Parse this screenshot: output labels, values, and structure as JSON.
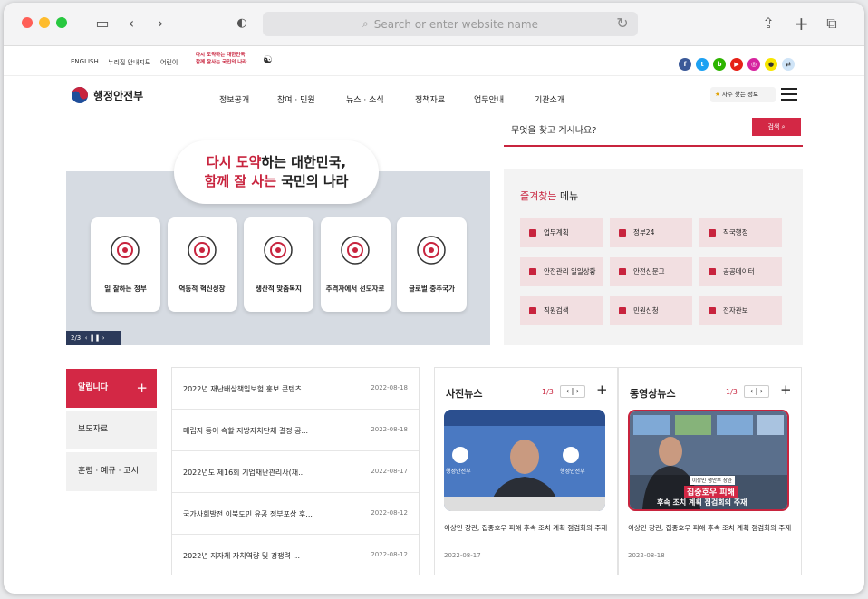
{
  "browser": {
    "url_placeholder": "Search or enter website name"
  },
  "util": {
    "english": "ENGLISH",
    "sitemap": "누리집 안내지도",
    "kids": "어린이",
    "slogan1": "다시 도약하는 대한민국",
    "slogan2": "함께 잘사는 국민의 나라"
  },
  "social": [
    {
      "name": "facebook-icon",
      "color": "#3b5998",
      "glyph": "f"
    },
    {
      "name": "twitter-icon",
      "color": "#1da1f2",
      "glyph": "t"
    },
    {
      "name": "blog-icon",
      "color": "#2db400",
      "glyph": "b"
    },
    {
      "name": "youtube-icon",
      "color": "#e62117",
      "glyph": "▶"
    },
    {
      "name": "instagram-icon",
      "color": "#d6249f",
      "glyph": "◎"
    },
    {
      "name": "kakao-icon",
      "color": "#f7e600",
      "glyph": "●"
    },
    {
      "name": "share-icon",
      "color": "#cfe4f7",
      "glyph": "⇄"
    }
  ],
  "header": {
    "logo": "행정안전부",
    "menu": [
      "정보공개",
      "참여 · 민원",
      "뉴스 · 소식",
      "정책자료",
      "업무안내",
      "기관소개"
    ],
    "fav": "자주 찾는 정보"
  },
  "search": {
    "placeholder": "무엇을 찾고 계시나요?",
    "button": "검색"
  },
  "hero": {
    "line1a": "다시 도약",
    "line1b": "하는 대한민국,",
    "line2a": "함께 잘 사는",
    "line2b": " 국민의 나라",
    "cards": [
      "일 잘하는 정부",
      "역동적 혁신성장",
      "생산적 맞춤복지",
      "추격자에서 선도자로",
      "글로벌 중추국가"
    ],
    "pager": "2/3"
  },
  "fav_menu": {
    "title_a": "즐겨찾는",
    "title_b": " 메뉴",
    "items": [
      "업무계획",
      "정부24",
      "직국행정",
      "안전관리 일일상황",
      "안전신문고",
      "공공데이터",
      "직원검색",
      "민원신청",
      "전자관보"
    ]
  },
  "tabs": [
    "알립니다",
    "보도자료",
    "훈령 · 예규 · 고시"
  ],
  "news": [
    {
      "title": "2022년 재난배상책임보험 홍보 콘텐츠...",
      "date": "2022-08-18"
    },
    {
      "title": "매립지 등이 속할 지방자치단체 결정 공...",
      "date": "2022-08-18"
    },
    {
      "title": "2022년도 제16회 기업재난관리사(재...",
      "date": "2022-08-17"
    },
    {
      "title": "국가사회발전 이북도민 유공 정부포상 후...",
      "date": "2022-08-12"
    },
    {
      "title": "2022년 지자체 자치역량 및 경쟁력 ...",
      "date": "2022-08-12"
    }
  ],
  "photo": {
    "title": "사진뉴스",
    "page": "1/3",
    "caption": "이상민 장관, 집중호우 피해 후속 조치 계획 점검회의 주재",
    "date": "2022-08-17",
    "logo": "행정안전부"
  },
  "video": {
    "title": "동영상뉴스",
    "page": "1/3",
    "caption": "이상민 장관, 집중호우 피해 후속 조치 계획 점검회의 주재",
    "date": "2022-08-18",
    "sub1": "이상민 행안부 장관",
    "sub2": "집중호우 피해",
    "sub3": "후속 조치 계획 점검회의 주재"
  },
  "colors": {
    "accent": "#c8243e",
    "navy": "#2c3a5a"
  }
}
